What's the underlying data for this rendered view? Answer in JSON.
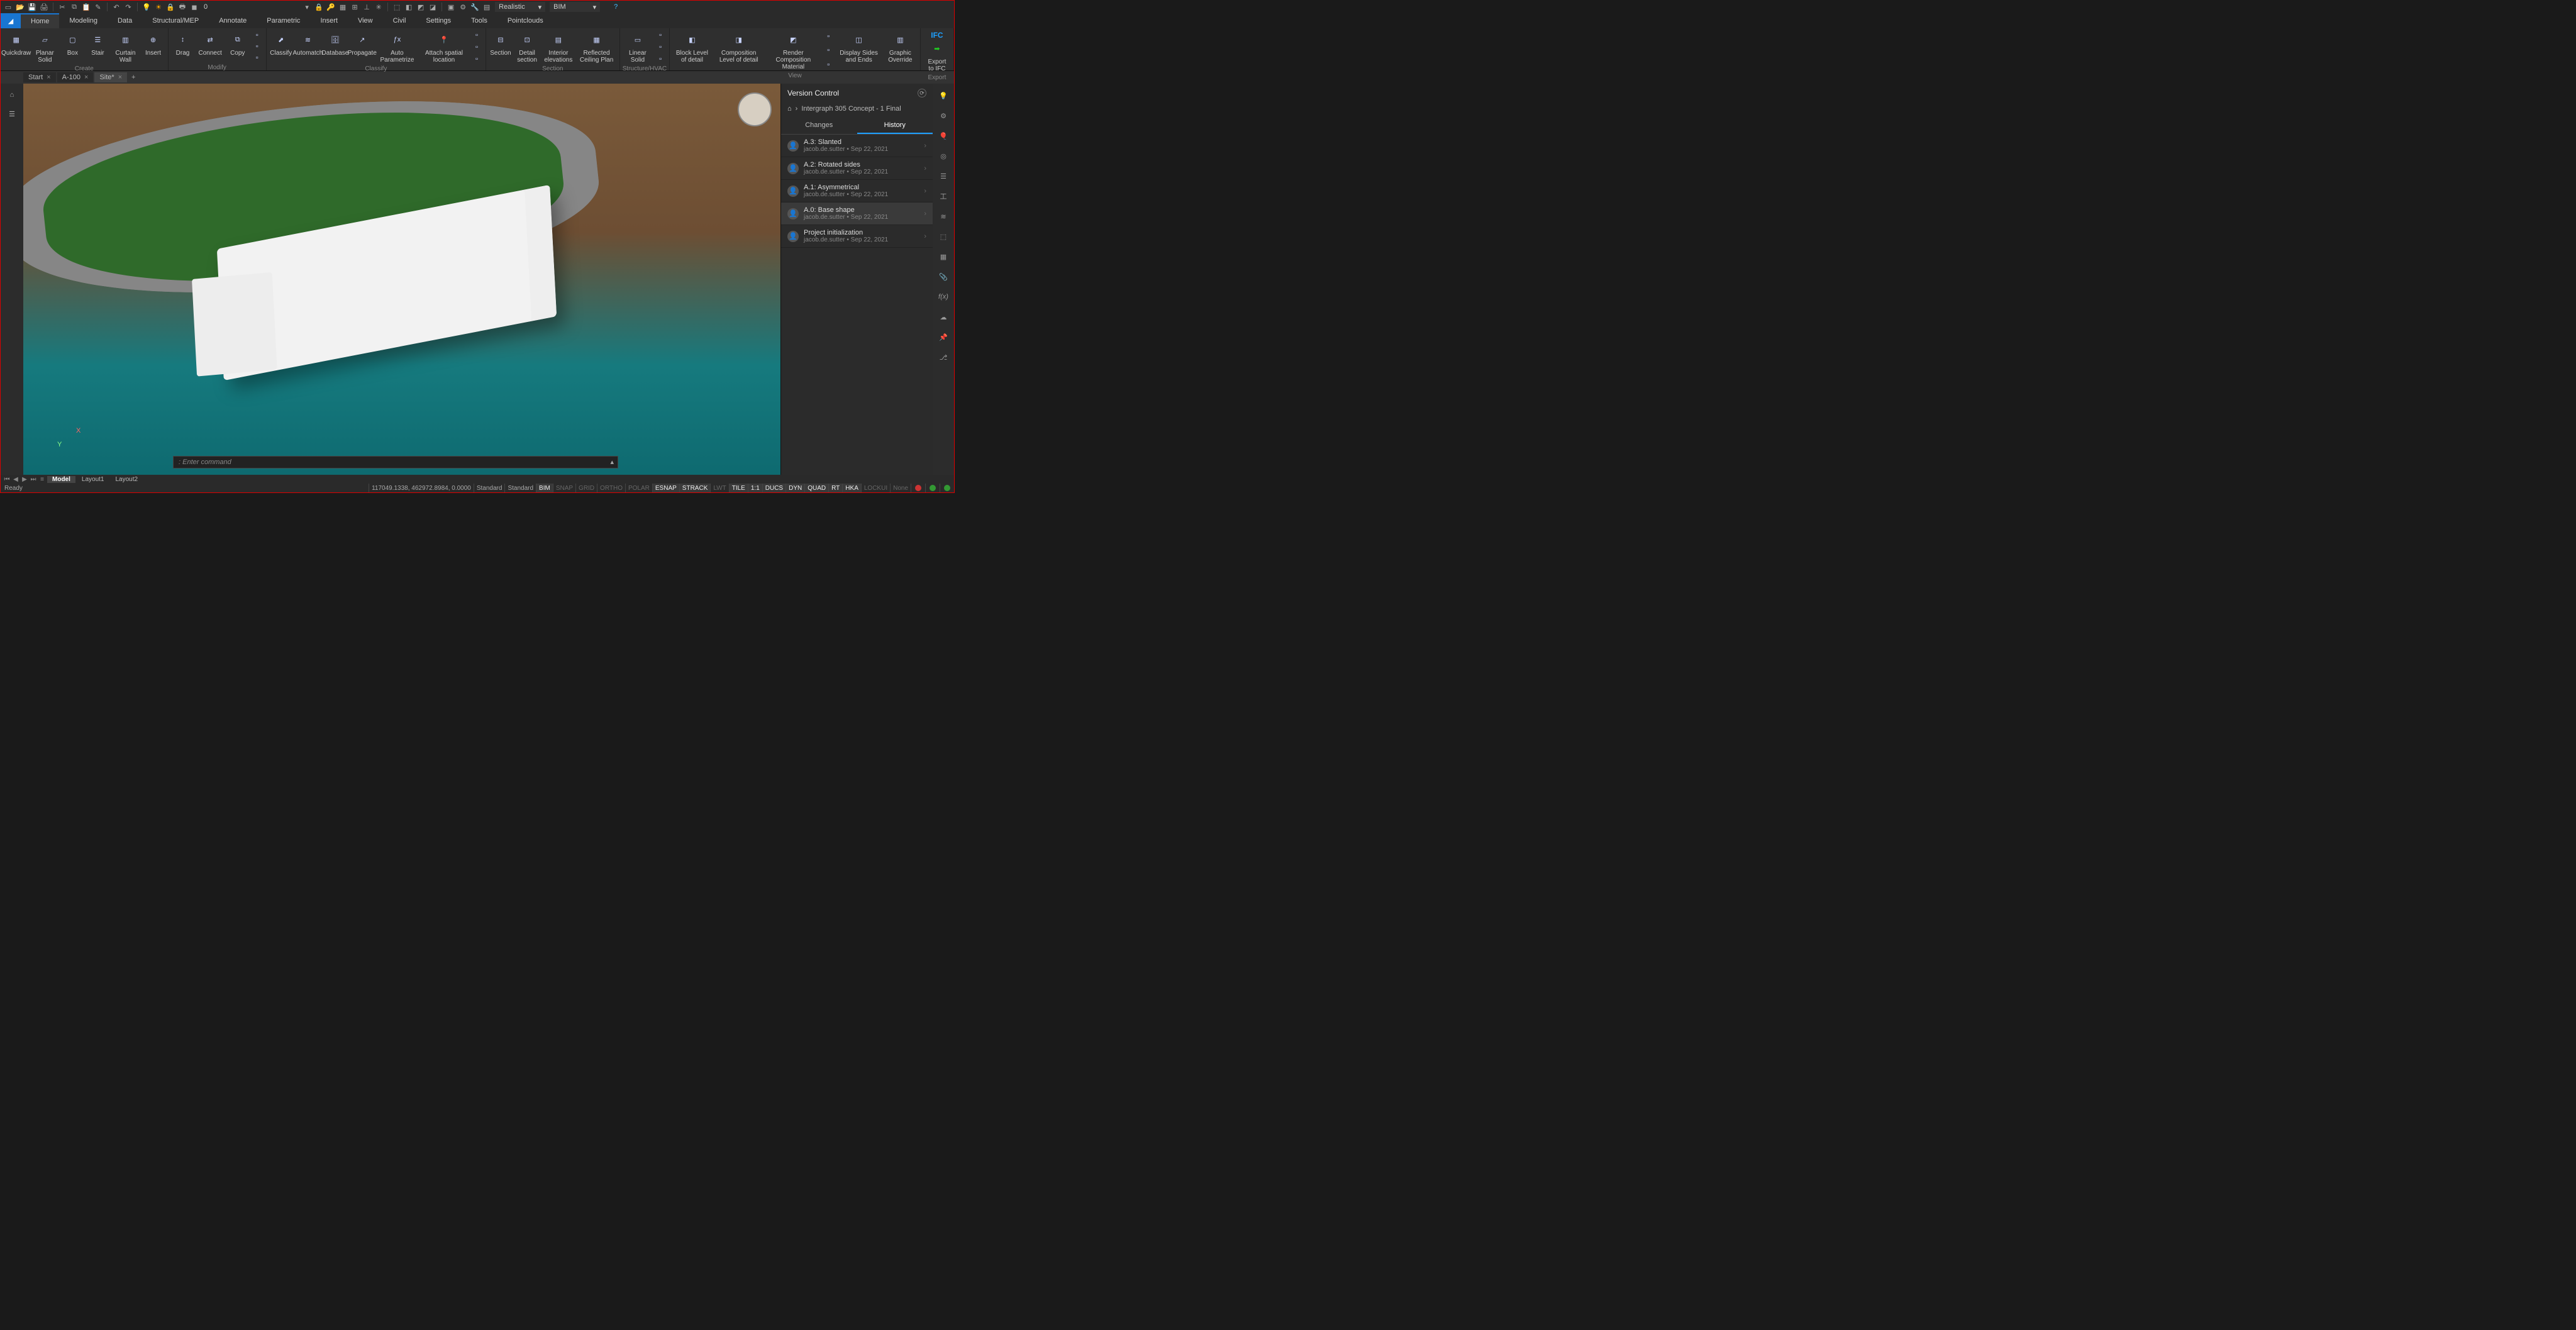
{
  "qat": {
    "layer_value": "0"
  },
  "combos": {
    "visual_style": "Realistic",
    "workspace": "BIM"
  },
  "ribbon_tabs": [
    "Home",
    "Modeling",
    "Data",
    "Structural/MEP",
    "Annotate",
    "Parametric",
    "Insert",
    "View",
    "Civil",
    "Settings",
    "Tools",
    "Pointclouds"
  ],
  "ribbon_active": 0,
  "ribbon": {
    "create": {
      "label": "Create",
      "items": [
        "Quickdraw",
        "Planar Solid",
        "Box",
        "Stair",
        "Curtain Wall",
        "Insert"
      ]
    },
    "modify": {
      "label": "Modify",
      "items": [
        "Drag",
        "Connect",
        "Copy"
      ]
    },
    "classify": {
      "label": "Classify",
      "items": [
        "Classify",
        "Automatch",
        "Database",
        "Propagate",
        "Auto Parametrize",
        "Attach spatial location"
      ]
    },
    "section": {
      "label": "Section",
      "items": [
        "Section",
        "Detail section",
        "Interior elevations",
        "Reflected Ceiling Plan"
      ]
    },
    "structure": {
      "label": "Structure/HVAC",
      "items": [
        "Linear Solid"
      ]
    },
    "view": {
      "label": "View",
      "items": [
        "Block Level of detail",
        "Composition Level of detail",
        "Render Composition Material",
        "Display Sides and Ends",
        "Graphic Override"
      ]
    },
    "export": {
      "label": "Export",
      "ifc": "IFC",
      "item": "Export to IFC"
    }
  },
  "doc_tabs": [
    {
      "label": "Start",
      "active": false
    },
    {
      "label": "A-100",
      "active": false
    },
    {
      "label": "Site*",
      "active": true
    }
  ],
  "version_control": {
    "title": "Version Control",
    "breadcrumb": "Intergraph 305 Concept - 1 Final",
    "tabs": [
      "Changes",
      "History"
    ],
    "active_tab": 1,
    "items": [
      {
        "title": "A.3: Slanted",
        "sub": "jacob.de.sutter • Sep 22, 2021",
        "sel": false
      },
      {
        "title": "A.2: Rotated sides",
        "sub": "jacob.de.sutter • Sep 22, 2021",
        "sel": false
      },
      {
        "title": "A.1: Asymmetrical",
        "sub": "jacob.de.sutter • Sep 22, 2021",
        "sel": false
      },
      {
        "title": "A.0: Base shape",
        "sub": "jacob.de.sutter • Sep 22, 2021",
        "sel": true
      },
      {
        "title": "Project initialization",
        "sub": "jacob.de.sutter • Sep 22, 2021",
        "sel": false
      }
    ]
  },
  "commandline": {
    "prompt": ":",
    "placeholder": "Enter command"
  },
  "bottom_tabs": [
    "Model",
    "Layout1",
    "Layout2"
  ],
  "bottom_active": 0,
  "axis": {
    "x": "X",
    "y": "Y",
    "z": ""
  },
  "status": {
    "ready": "Ready",
    "coords": "117049.1338, 462972.8984, 0.0000",
    "std1": "Standard",
    "std2": "Standard",
    "toggles": [
      "BIM",
      "SNAP",
      "GRID",
      "ORTHO",
      "POLAR",
      "ESNAP",
      "STRACK",
      "LWT",
      "TILE",
      "1:1",
      "DUCS",
      "DYN",
      "QUAD",
      "RT",
      "HKA",
      "LOCKUI",
      "None"
    ]
  }
}
